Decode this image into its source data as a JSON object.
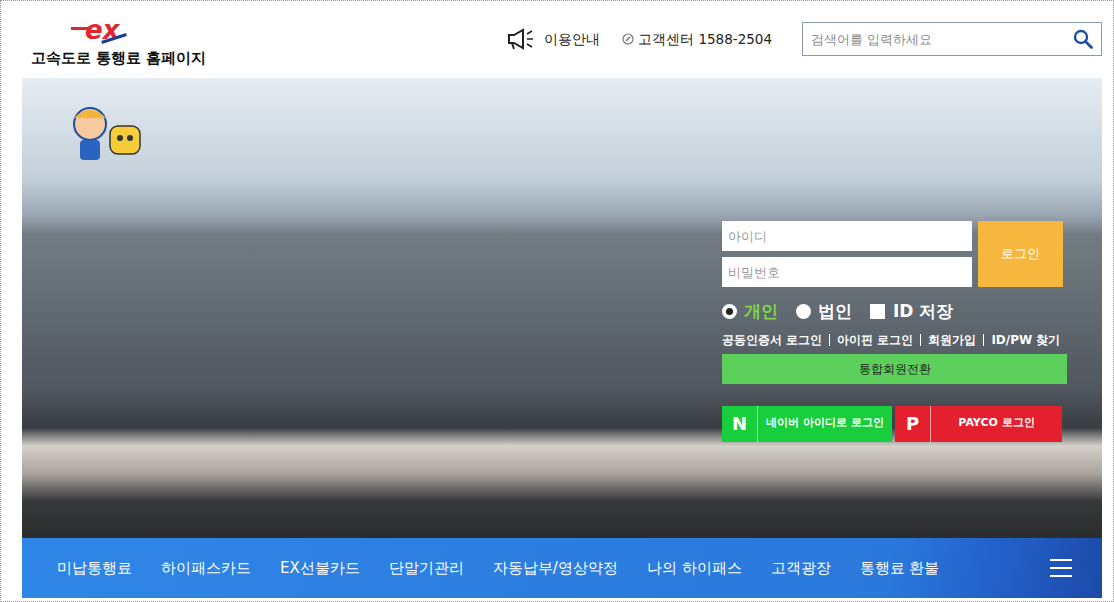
{
  "header": {
    "logo_mark": "ex",
    "logo_title": "고속도로 통행료 홈페이지",
    "guide": "이용안내",
    "call_center": "고객센터 1588-2504",
    "search": {
      "placeholder": "검색어를 입력하세요"
    }
  },
  "login": {
    "id_placeholder": "아이디",
    "password_placeholder": "비밀번호",
    "button": "로그인",
    "member_types": [
      {
        "label": "개인",
        "selected": true
      },
      {
        "label": "법인",
        "selected": false
      }
    ],
    "save_id": {
      "label": "ID 저장",
      "checked": false
    },
    "links": [
      "공동인증서 로그인",
      "아이핀 로그인",
      "회원가입",
      "ID/PW 찾기"
    ],
    "convert": "통합회원전환",
    "social": [
      {
        "mark": "N",
        "label": "네이버 아이디로 로그인",
        "color": "#19ce3c"
      },
      {
        "mark": "P",
        "label": "PAYCO 로그인",
        "color": "#e5202e"
      }
    ]
  },
  "menu": {
    "items": [
      "미납통행료",
      "하이패스카드",
      "EX선불카드",
      "단말기관리",
      "자동납부/영상약정",
      "나의 하이패스",
      "고객광장",
      "통행료 환불"
    ]
  }
}
